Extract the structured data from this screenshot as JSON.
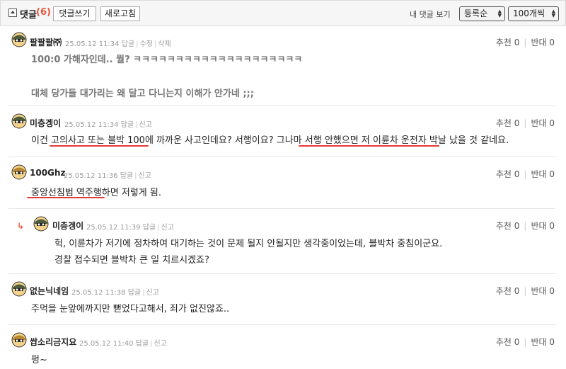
{
  "toolbar": {
    "title": "댓글",
    "count": "(6)",
    "write_label": "댓글쓰기",
    "refresh_label": "새로고침",
    "my_comments": "내 댓글 보기",
    "order_value": "등록순",
    "per_page_value": "100개씩"
  },
  "comments": [
    {
      "nick": "팔팔팔㈜",
      "date": "25.05.12 11:34",
      "actions": [
        "답글",
        "수정",
        "삭제"
      ],
      "up_label": "추천",
      "up": "0",
      "down_label": "반대",
      "down": "0",
      "lines": [
        "100:0 가해자인데.. 뭘? ㅋㅋㅋㅋㅋㅋㅋㅋㅋㅋㅋㅋㅋㅋㅋㅋㅋㅋㅋㅋ",
        "대체 당가들 대가리는 왜 달고 다니는지 이해가 안가네 ;;;"
      ]
    },
    {
      "nick": "미층겡이",
      "date": "25.05.12 11:34",
      "actions": [
        "답글",
        "신고"
      ],
      "up_label": "추천",
      "up": "0",
      "down_label": "반대",
      "down": "0",
      "lines": [
        "이건 고의사고 또는 블박 100에 까까운 사고인데요? 서행이요? 그나마 서행 안했으면 저 이륜차 운전자 박날 났을 것 같네요."
      ]
    },
    {
      "nick": "100Ghz",
      "date": "25.05.12 11:36",
      "actions": [
        "답글",
        "신고"
      ],
      "up_label": "추천",
      "up": "0",
      "down_label": "반대",
      "down": "0",
      "lines": [
        "중앙선침범 역주행하면 저렇게 됨."
      ]
    },
    {
      "reply_arrow": "↳",
      "nick": "미층겡이",
      "date": "25.05.12 11:39",
      "actions": [
        "답글",
        "신고"
      ],
      "up_label": "추천",
      "up": "0",
      "down_label": "반대",
      "down": "0",
      "lines": [
        "헉, 이륜차가 저기에 정차하여 대기하는 것이 문제 될지 안될지만 생각중이었는데, 블박차 중침이군요.",
        "경찰 접수되면 블박차 큰 일 치르시겠죠?"
      ]
    },
    {
      "nick": "없는닉네임",
      "date": "25.05.12 11:38",
      "actions": [
        "답글",
        "신고"
      ],
      "up_label": "추천",
      "up": "0",
      "down_label": "반대",
      "down": "0",
      "lines": [
        "주먹을 눈앞에까지만 뻗었다고해서, 죄가 없진않죠.."
      ]
    },
    {
      "nick": "쌉소리금지요",
      "date": "25.05.12 11:40",
      "actions": [
        "답글",
        "신고"
      ],
      "up_label": "추천",
      "up": "0",
      "down_label": "반대",
      "down": "0",
      "lines": [
        "펑~"
      ]
    }
  ],
  "colors": {
    "accent": "#e8563c",
    "underline": "#e53935"
  }
}
